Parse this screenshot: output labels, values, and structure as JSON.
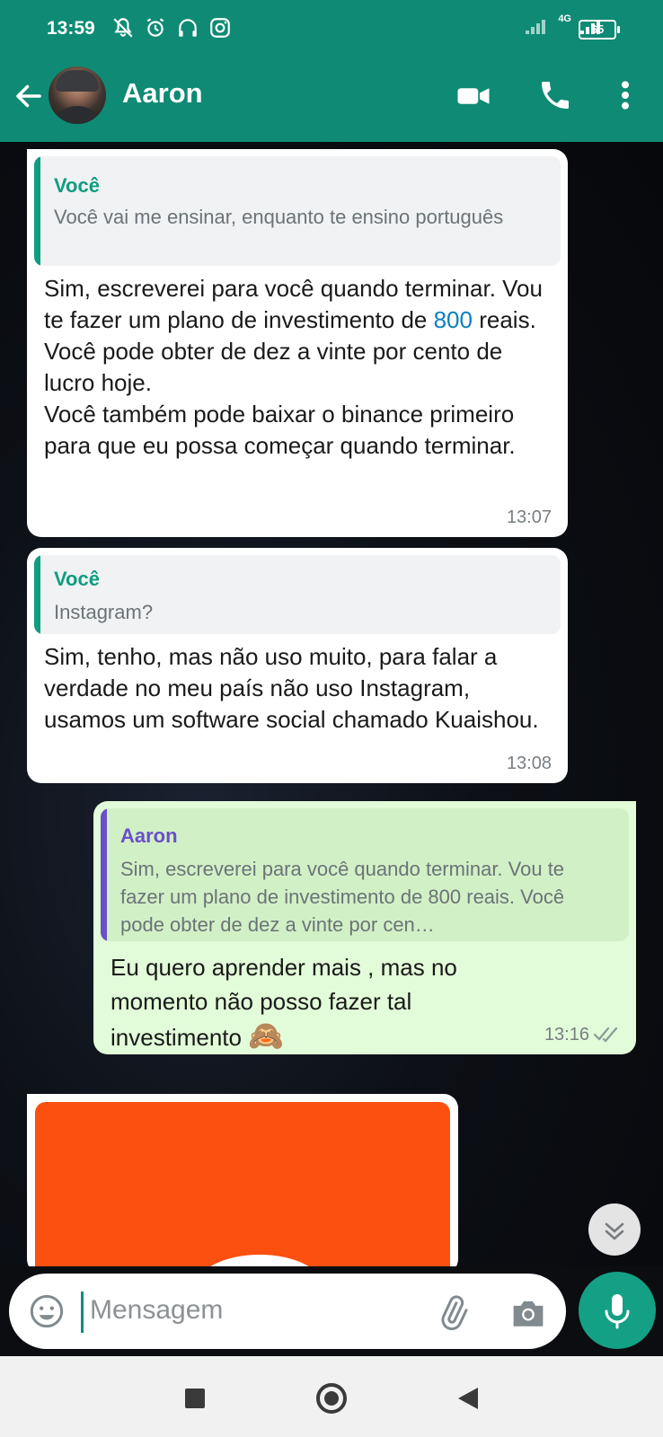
{
  "status_bar": {
    "time": "13:59",
    "network": "4G",
    "battery": "65"
  },
  "contact": {
    "name": "Aaron"
  },
  "messages": [
    {
      "direction": "incoming",
      "quote": {
        "author": "Você",
        "text": "Você vai me ensinar, enquanto te ensino português"
      },
      "text_before": "Sim, escreverei para você quando terminar. Vou te fazer um plano de investimento de ",
      "number": "800",
      "text_after": " reais. Você pode obter de dez a vinte por cento de lucro hoje.\nVocê também pode baixar o binance primeiro para que eu possa começar quando terminar.",
      "time": "13:07"
    },
    {
      "direction": "incoming",
      "quote": {
        "author": "Você",
        "text": "Instagram?"
      },
      "text": "Sim, tenho, mas não uso muito, para falar a verdade no meu país não uso Instagram, usamos um software social chamado Kuaishou.",
      "time": "13:08"
    },
    {
      "direction": "outgoing",
      "quote": {
        "author": "Aaron",
        "text": "Sim, escreverei para você quando terminar. Vou te fazer um plano de investimento de 800 reais. Você pode obter de dez a vinte por cen…"
      },
      "text": "Eu quero aprender mais , mas no momento não posso fazer tal investimento",
      "emoji": "🙈",
      "time": "13:16",
      "status": "read"
    }
  ],
  "composer": {
    "placeholder": "Mensagem"
  },
  "colors": {
    "header": "#0f8a75",
    "accent_green": "#14a085",
    "outgoing_bubble": "#e2fbd8",
    "quote_you": "#0f9d80",
    "quote_aaron": "#6a4fc9"
  },
  "icons": [
    "back-arrow-icon",
    "video-call-icon",
    "phone-call-icon",
    "more-options-icon",
    "emoji-icon",
    "attach-icon",
    "camera-icon",
    "mic-icon",
    "scroll-down-icon",
    "read-receipt-icon"
  ]
}
